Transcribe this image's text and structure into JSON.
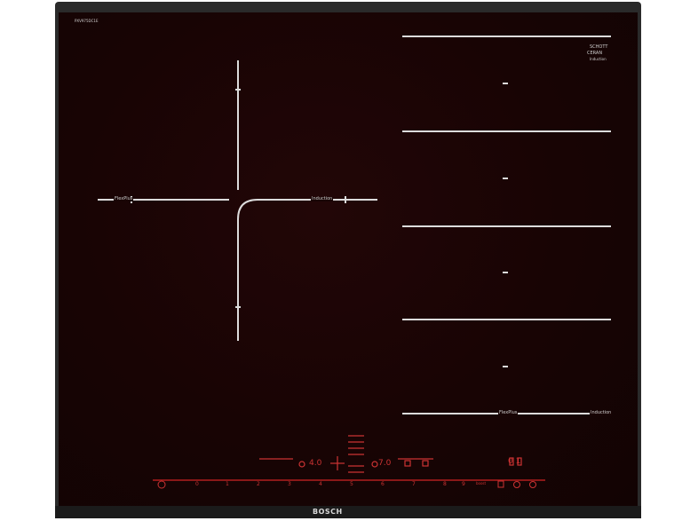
{
  "top_left_model": "PXV975DC1E",
  "schott_logo": [
    "SCHOTT",
    "CERAN",
    "Induction"
  ],
  "left_zone_labels": {
    "left": "FlexPlus",
    "right": "Induction"
  },
  "right_zone_labels": {
    "left": "FlexPlus",
    "right": "Induction"
  },
  "control_values": {
    "left_display": "4.0",
    "center_display": "7.0",
    "right_display": "0 1"
  },
  "power_scale": [
    "0",
    "1",
    "2",
    "3",
    "4",
    "5",
    "6",
    "7",
    "8",
    "9",
    "boost"
  ],
  "brand": "BOSCH",
  "colors": {
    "glass": "#180404",
    "accent_red": "#c02222",
    "frame": "#2a2a2a"
  }
}
